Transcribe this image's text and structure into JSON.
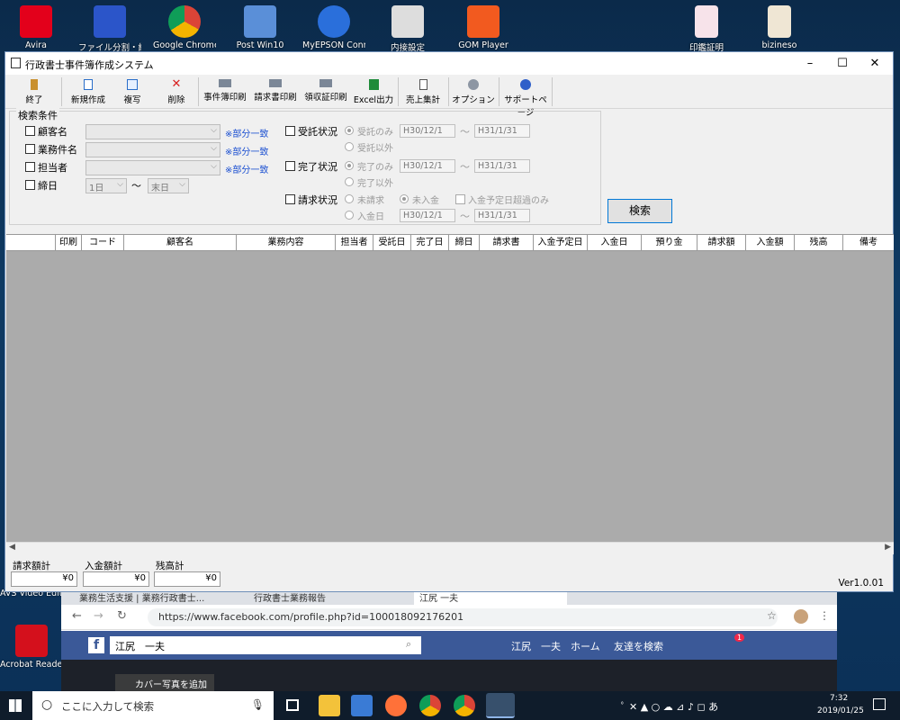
{
  "desktop": {
    "icons": [
      "Avira",
      "ファイル分割・結合",
      "Google Chrome",
      "Post Win10",
      "MyEPSON Connect",
      "内接設定",
      "GOM Player",
      "印鑑証明",
      "bizineso",
      "AVS Video Editor",
      "Acrobat Reader"
    ]
  },
  "browser": {
    "tabs": [
      "業務生活支援 | 業務行政書士...",
      "行政書士業務報告",
      "江尻 一夫"
    ],
    "url": "https://www.facebook.com/profile.php?id=100018092176201",
    "fb_search": "江尻　一夫",
    "fb_name": "江尻　一夫",
    "fb_home": "ホーム",
    "fb_find_friends": "友達を検索",
    "fb_badge": "1",
    "cover_btn": "カバー写真を追加"
  },
  "window": {
    "title": "行政書士事件簿作成システム",
    "toolbar": {
      "exit": "終了",
      "new": "新規作成",
      "copy": "複写",
      "delete": "削除",
      "case_print": "事件簿印刷",
      "invoice_print": "請求書印刷",
      "receipt_print": "領収証印刷",
      "excel": "Excel出力",
      "sales": "売上集計",
      "options": "オプション",
      "support": "サポートページ"
    },
    "search": {
      "legend": "検索条件",
      "client": "顧客名",
      "project": "業務件名",
      "person": "担当者",
      "weekday": "締日",
      "partial": "※部分一致",
      "day_from": "1日",
      "day_to": "末日",
      "tilde": "〜",
      "entrust": "受託状況",
      "entrust_only": "受託のみ",
      "entrust_other": "受託以外",
      "complete": "完了状況",
      "complete_only": "完了のみ",
      "complete_other": "完了以外",
      "billing": "請求状況",
      "unbilled": "未請求",
      "unpaid": "未入金",
      "overdue": "入金予定日超過のみ",
      "paid_date": "入金日",
      "date_from": "H30/12/1",
      "date_to": "H31/1/31",
      "search_btn": "検索"
    },
    "columns": [
      "印刷",
      "コード",
      "顧客名",
      "業務内容",
      "担当者",
      "受託日",
      "完了日",
      "締日",
      "請求書",
      "入金予定日",
      "入金日",
      "預り金",
      "請求額",
      "入金額",
      "残高",
      "備考"
    ],
    "totals": {
      "billed_label": "請求額計",
      "billed": "¥0",
      "received_label": "入金額計",
      "received": "¥0",
      "balance_label": "残高計",
      "balance": "¥0"
    },
    "version": "Ver1.0.01"
  },
  "taskbar": {
    "search": "ここに入力して検索",
    "time": "7:32",
    "date": "2019/01/25"
  }
}
